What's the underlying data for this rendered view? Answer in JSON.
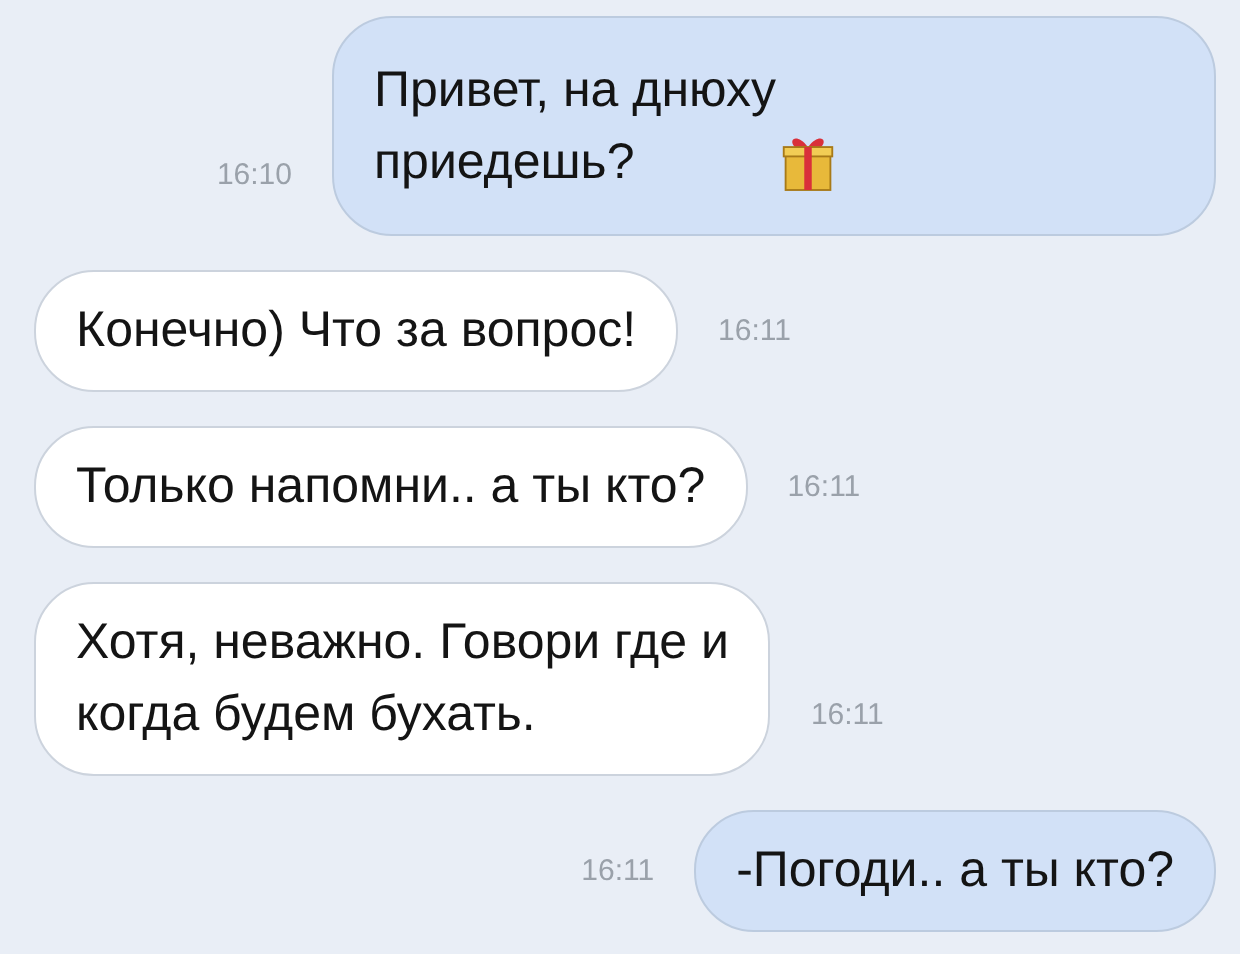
{
  "messages": [
    {
      "kind": "outgoing",
      "text": "Привет, на днюху\nприедешь?",
      "time": "16:10"
    },
    {
      "kind": "incoming",
      "text": "Конечно) Что за вопрос!",
      "time": "16:11"
    },
    {
      "kind": "incoming",
      "text": "Только напомни.. а ты кто?",
      "time": "16:11"
    },
    {
      "kind": "incoming",
      "text": "Хотя, неважно. Говори где и\nкогда будем бухать.",
      "time": "16:11"
    },
    {
      "kind": "outgoing",
      "text": "-Погоди.. а ты кто?",
      "time": "16:11"
    }
  ]
}
